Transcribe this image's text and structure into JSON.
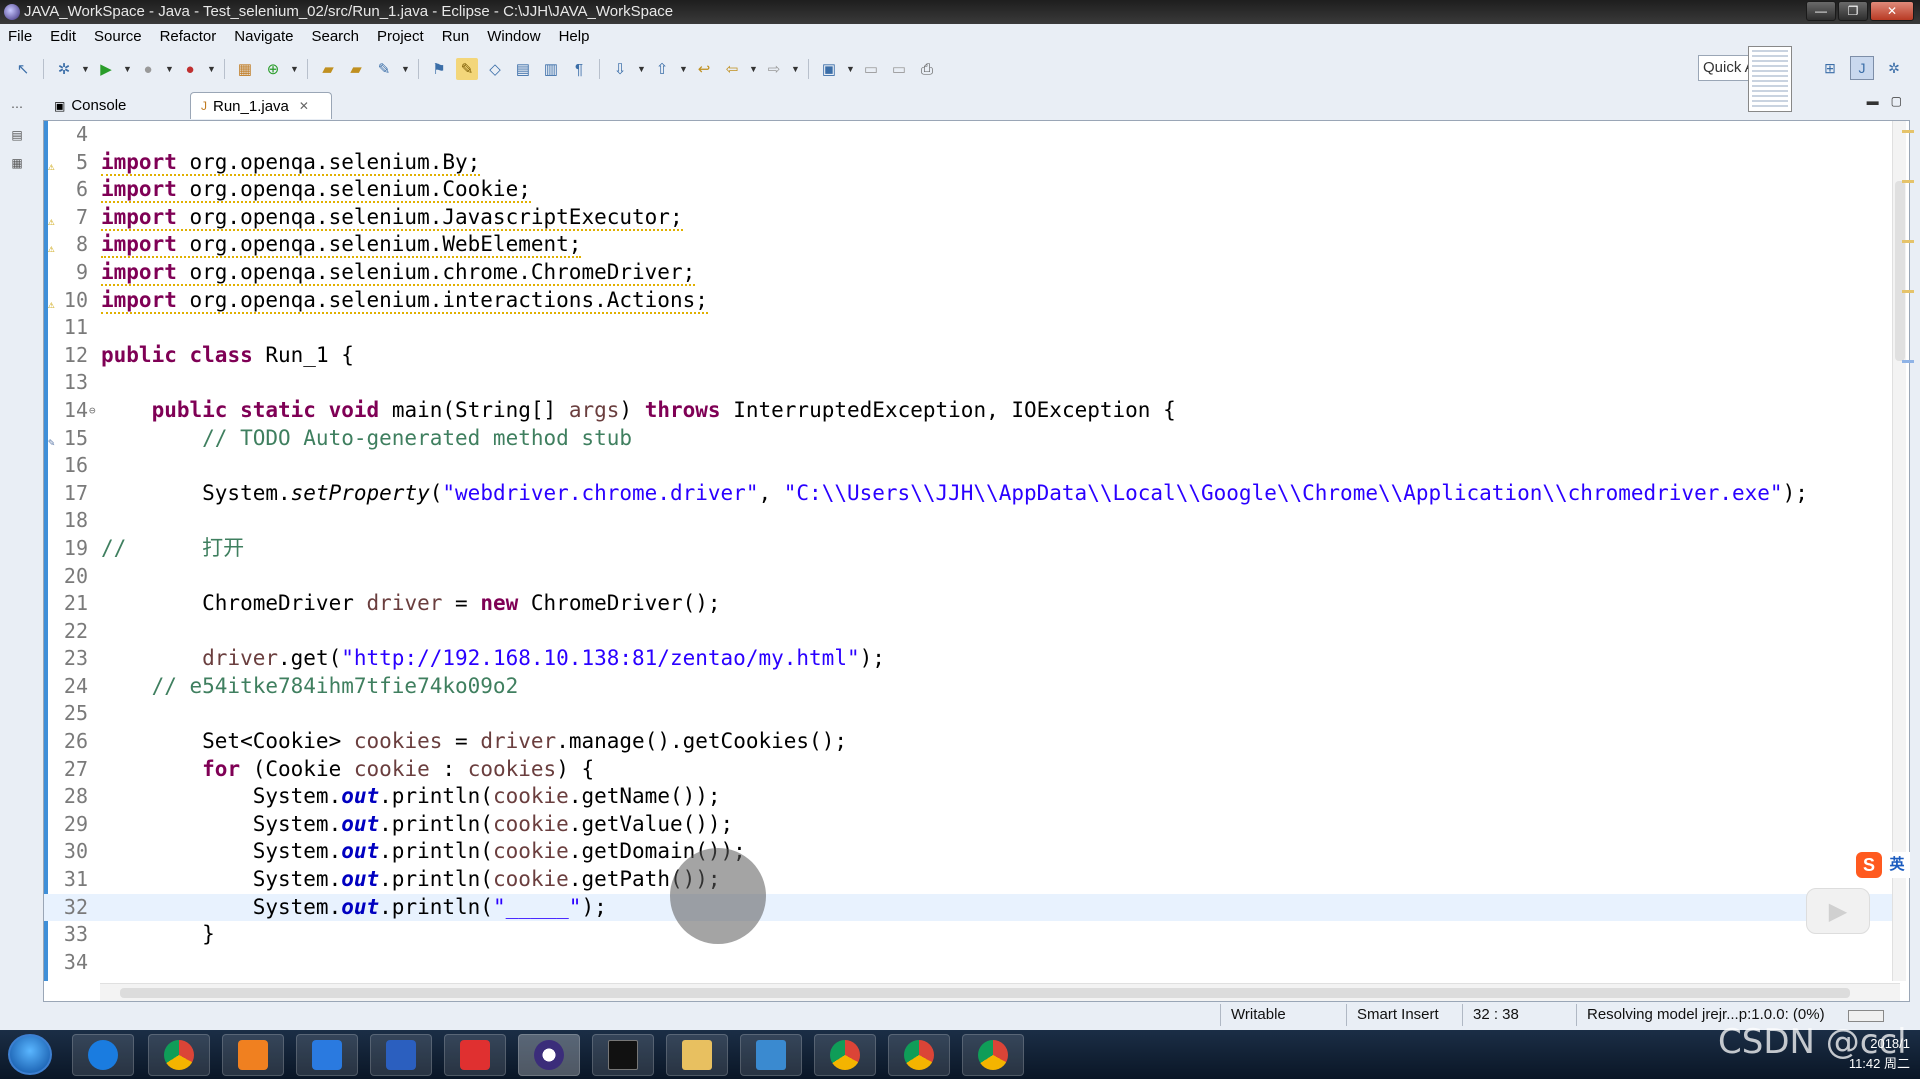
{
  "window": {
    "title": "JAVA_WorkSpace - Java - Test_selenium_02/src/Run_1.java - Eclipse - C:\\JJH\\JAVA_WorkSpace"
  },
  "menu": [
    "File",
    "Edit",
    "Source",
    "Refactor",
    "Navigate",
    "Search",
    "Project",
    "Run",
    "Window",
    "Help"
  ],
  "toolbar": {
    "quick_access": "Quick Access"
  },
  "tabs": {
    "console": "Console",
    "editor": "Run_1.java"
  },
  "code_lines": [
    {
      "n": "4",
      "code": ""
    },
    {
      "n": "5",
      "code": "import org.openqa.selenium.By;"
    },
    {
      "n": "6",
      "code": "import org.openqa.selenium.Cookie;"
    },
    {
      "n": "7",
      "code": "import org.openqa.selenium.JavascriptExecutor;"
    },
    {
      "n": "8",
      "code": "import org.openqa.selenium.WebElement;"
    },
    {
      "n": "9",
      "code": "import org.openqa.selenium.chrome.ChromeDriver;"
    },
    {
      "n": "10",
      "code": "import org.openqa.selenium.interactions.Actions;"
    },
    {
      "n": "11",
      "code": ""
    },
    {
      "n": "12",
      "code": "public class Run_1 {"
    },
    {
      "n": "13",
      "code": ""
    },
    {
      "n": "14",
      "code": "    public static void main(String[] args) throws InterruptedException, IOException {"
    },
    {
      "n": "15",
      "code": "        // TODO Auto-generated method stub"
    },
    {
      "n": "16",
      "code": ""
    },
    {
      "n": "17",
      "code": "        System.setProperty(\"webdriver.chrome.driver\", \"C:\\\\Users\\\\JJH\\\\AppData\\\\Local\\\\Google\\\\Chrome\\\\Application\\\\chromedriver.exe\");"
    },
    {
      "n": "18",
      "code": ""
    },
    {
      "n": "19",
      "code": "//      打开"
    },
    {
      "n": "20",
      "code": ""
    },
    {
      "n": "21",
      "code": "        ChromeDriver driver = new ChromeDriver();"
    },
    {
      "n": "22",
      "code": ""
    },
    {
      "n": "23",
      "code": "        driver.get(\"http://192.168.10.138:81/zentao/my.html\");"
    },
    {
      "n": "24",
      "code": "    // e54itke784ihm7tfie74ko09o2"
    },
    {
      "n": "25",
      "code": ""
    },
    {
      "n": "26",
      "code": "        Set<Cookie> cookies = driver.manage().getCookies();"
    },
    {
      "n": "27",
      "code": "        for (Cookie cookie : cookies) {"
    },
    {
      "n": "28",
      "code": "            System.out.println(cookie.getName());"
    },
    {
      "n": "29",
      "code": "            System.out.println(cookie.getValue());"
    },
    {
      "n": "30",
      "code": "            System.out.println(cookie.getDomain());"
    },
    {
      "n": "31",
      "code": "            System.out.println(cookie.getPath());"
    },
    {
      "n": "32",
      "code": "            System.out.println(\"_____\");"
    },
    {
      "n": "33",
      "code": "        }"
    },
    {
      "n": "34",
      "code": ""
    }
  ],
  "status": {
    "writable": "Writable",
    "insert_mode": "Smart Insert",
    "position": "32 : 38",
    "message": "Resolving model jrejr...p:1.0.0: (0%)"
  },
  "ime": {
    "badge": "S",
    "lang": "英"
  },
  "tray": {
    "time": "11:42 周二",
    "tray_text": "2018/1"
  },
  "watermark": "CSDN @ccl",
  "colors": {
    "keyword": "#7f0055",
    "string": "#2a00ff",
    "comment": "#3f7f5f",
    "field": "#0000c0",
    "current_line": "#e8f2fe"
  }
}
